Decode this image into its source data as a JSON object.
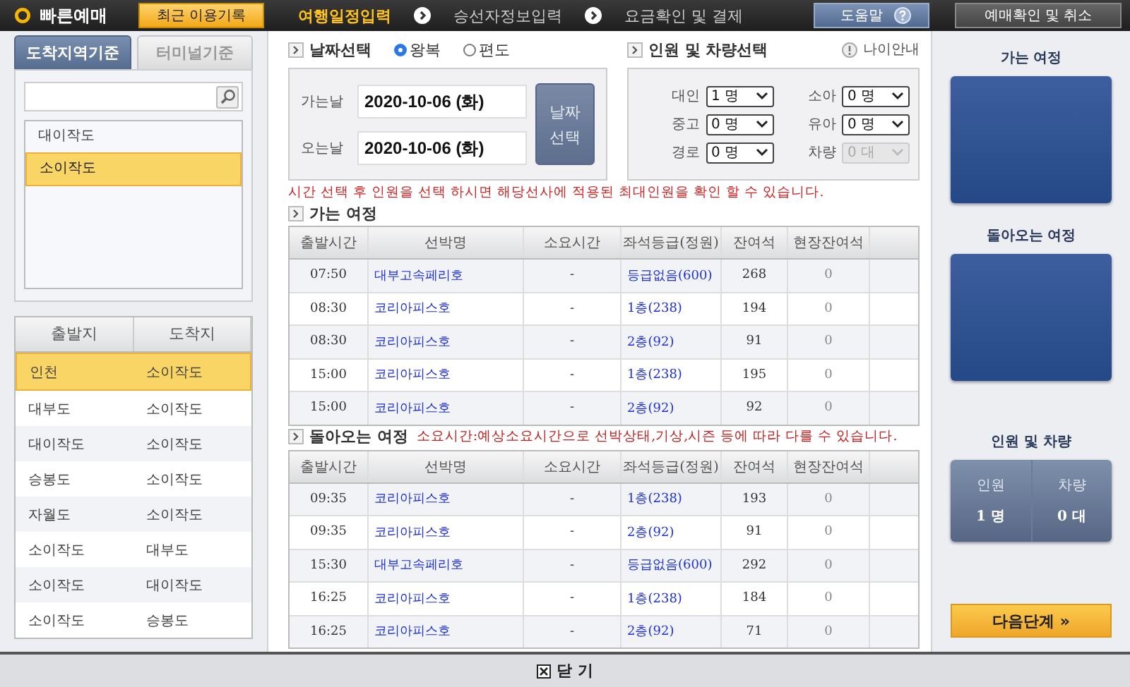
{
  "topbar": {
    "logo": "빠른예매",
    "recent_button": "최근 이용기록",
    "steps": [
      {
        "label": "여행일정입력",
        "selected": true
      },
      {
        "label": "승선자정보입력",
        "selected": false
      },
      {
        "label": "요금확인 및 결제",
        "selected": false
      }
    ],
    "help_button": "도움말",
    "confirm_button": "예매확인 및 취소"
  },
  "left": {
    "tabs": [
      {
        "label": "도착지역기준",
        "selected": true
      },
      {
        "label": "터미널기준",
        "selected": false
      }
    ],
    "regions": [
      {
        "label": "대이작도",
        "selected": false
      },
      {
        "label": "소이작도",
        "selected": true
      }
    ],
    "routes": {
      "columns": [
        "출발지",
        "도착지"
      ],
      "rows": [
        {
          "from": "인천",
          "to": "소이작도",
          "selected": true
        },
        {
          "from": "대부도",
          "to": "소이작도",
          "selected": false
        },
        {
          "from": "대이작도",
          "to": "소이작도",
          "selected": false
        },
        {
          "from": "승봉도",
          "to": "소이작도",
          "selected": false
        },
        {
          "from": "자월도",
          "to": "소이작도",
          "selected": false
        },
        {
          "from": "소이작도",
          "to": "대부도",
          "selected": false
        },
        {
          "from": "소이작도",
          "to": "대이작도",
          "selected": false
        },
        {
          "from": "소이작도",
          "to": "승봉도",
          "selected": false
        }
      ]
    }
  },
  "date_section": {
    "title": "날짜선택",
    "trip_options": [
      {
        "label": "왕복",
        "selected": true
      },
      {
        "label": "편도",
        "selected": false
      }
    ],
    "go_label": "가는날",
    "go_date": "2020-10-06 (화)",
    "return_label": "오는날",
    "return_date": "2020-10-06 (화)",
    "pick_button": [
      "날짜",
      "선택"
    ]
  },
  "passenger_section": {
    "title": "인원 및 차량선택",
    "age_info": "나이안내",
    "fields": [
      {
        "label": "대인",
        "value": "1 명",
        "disabled": false
      },
      {
        "label": "소아",
        "value": "0 명",
        "disabled": false
      },
      {
        "label": "중고",
        "value": "0 명",
        "disabled": false
      },
      {
        "label": "유아",
        "value": "0 명",
        "disabled": false
      },
      {
        "label": "경로",
        "value": "0 명",
        "disabled": false
      },
      {
        "label": "차량",
        "value": "0 대",
        "disabled": true
      }
    ]
  },
  "notice": "시간 선택 후 인원을 선택 하시면 해당선사에 적용된 최대인원을 확인 할 수 있습니다.",
  "outbound": {
    "title": "가는 여정",
    "columns": [
      "출발시간",
      "선박명",
      "소요시간",
      "좌석등급(정원)",
      "잔여석",
      "현장잔여석"
    ],
    "rows": [
      [
        "07:50",
        "대부고속페리호",
        "-",
        "등급없음(600)",
        "268",
        "0"
      ],
      [
        "08:30",
        "코리아피스호",
        "-",
        "1층(238)",
        "194",
        "0"
      ],
      [
        "08:30",
        "코리아피스호",
        "-",
        "2층(92)",
        "91",
        "0"
      ],
      [
        "15:00",
        "코리아피스호",
        "-",
        "1층(238)",
        "195",
        "0"
      ],
      [
        "15:00",
        "코리아피스호",
        "-",
        "2층(92)",
        "92",
        "0"
      ]
    ]
  },
  "return": {
    "title": "돌아오는 여정",
    "note": "소요시간:예상소요시간으로 선박상태,기상,시즌 등에 따라 다를 수 있습니다.",
    "columns": [
      "출발시간",
      "선박명",
      "소요시간",
      "좌석등급(정원)",
      "잔여석",
      "현장잔여석"
    ],
    "rows": [
      [
        "09:35",
        "코리아피스호",
        "-",
        "1층(238)",
        "193",
        "0"
      ],
      [
        "09:35",
        "코리아피스호",
        "-",
        "2층(92)",
        "91",
        "0"
      ],
      [
        "15:30",
        "대부고속페리호",
        "-",
        "등급없음(600)",
        "292",
        "0"
      ],
      [
        "16:25",
        "코리아피스호",
        "-",
        "1층(238)",
        "184",
        "0"
      ],
      [
        "16:25",
        "코리아피스호",
        "-",
        "2층(92)",
        "71",
        "0"
      ]
    ]
  },
  "right": {
    "outbound_title": "가는 여정",
    "return_title": "돌아오는 여정",
    "summary_title": "인원 및 차량",
    "people_label": "인원",
    "people_value": "1 명",
    "vehicle_label": "차량",
    "vehicle_value": "0 대",
    "next_button": "다음단계 »"
  },
  "close_button": "닫 기"
}
